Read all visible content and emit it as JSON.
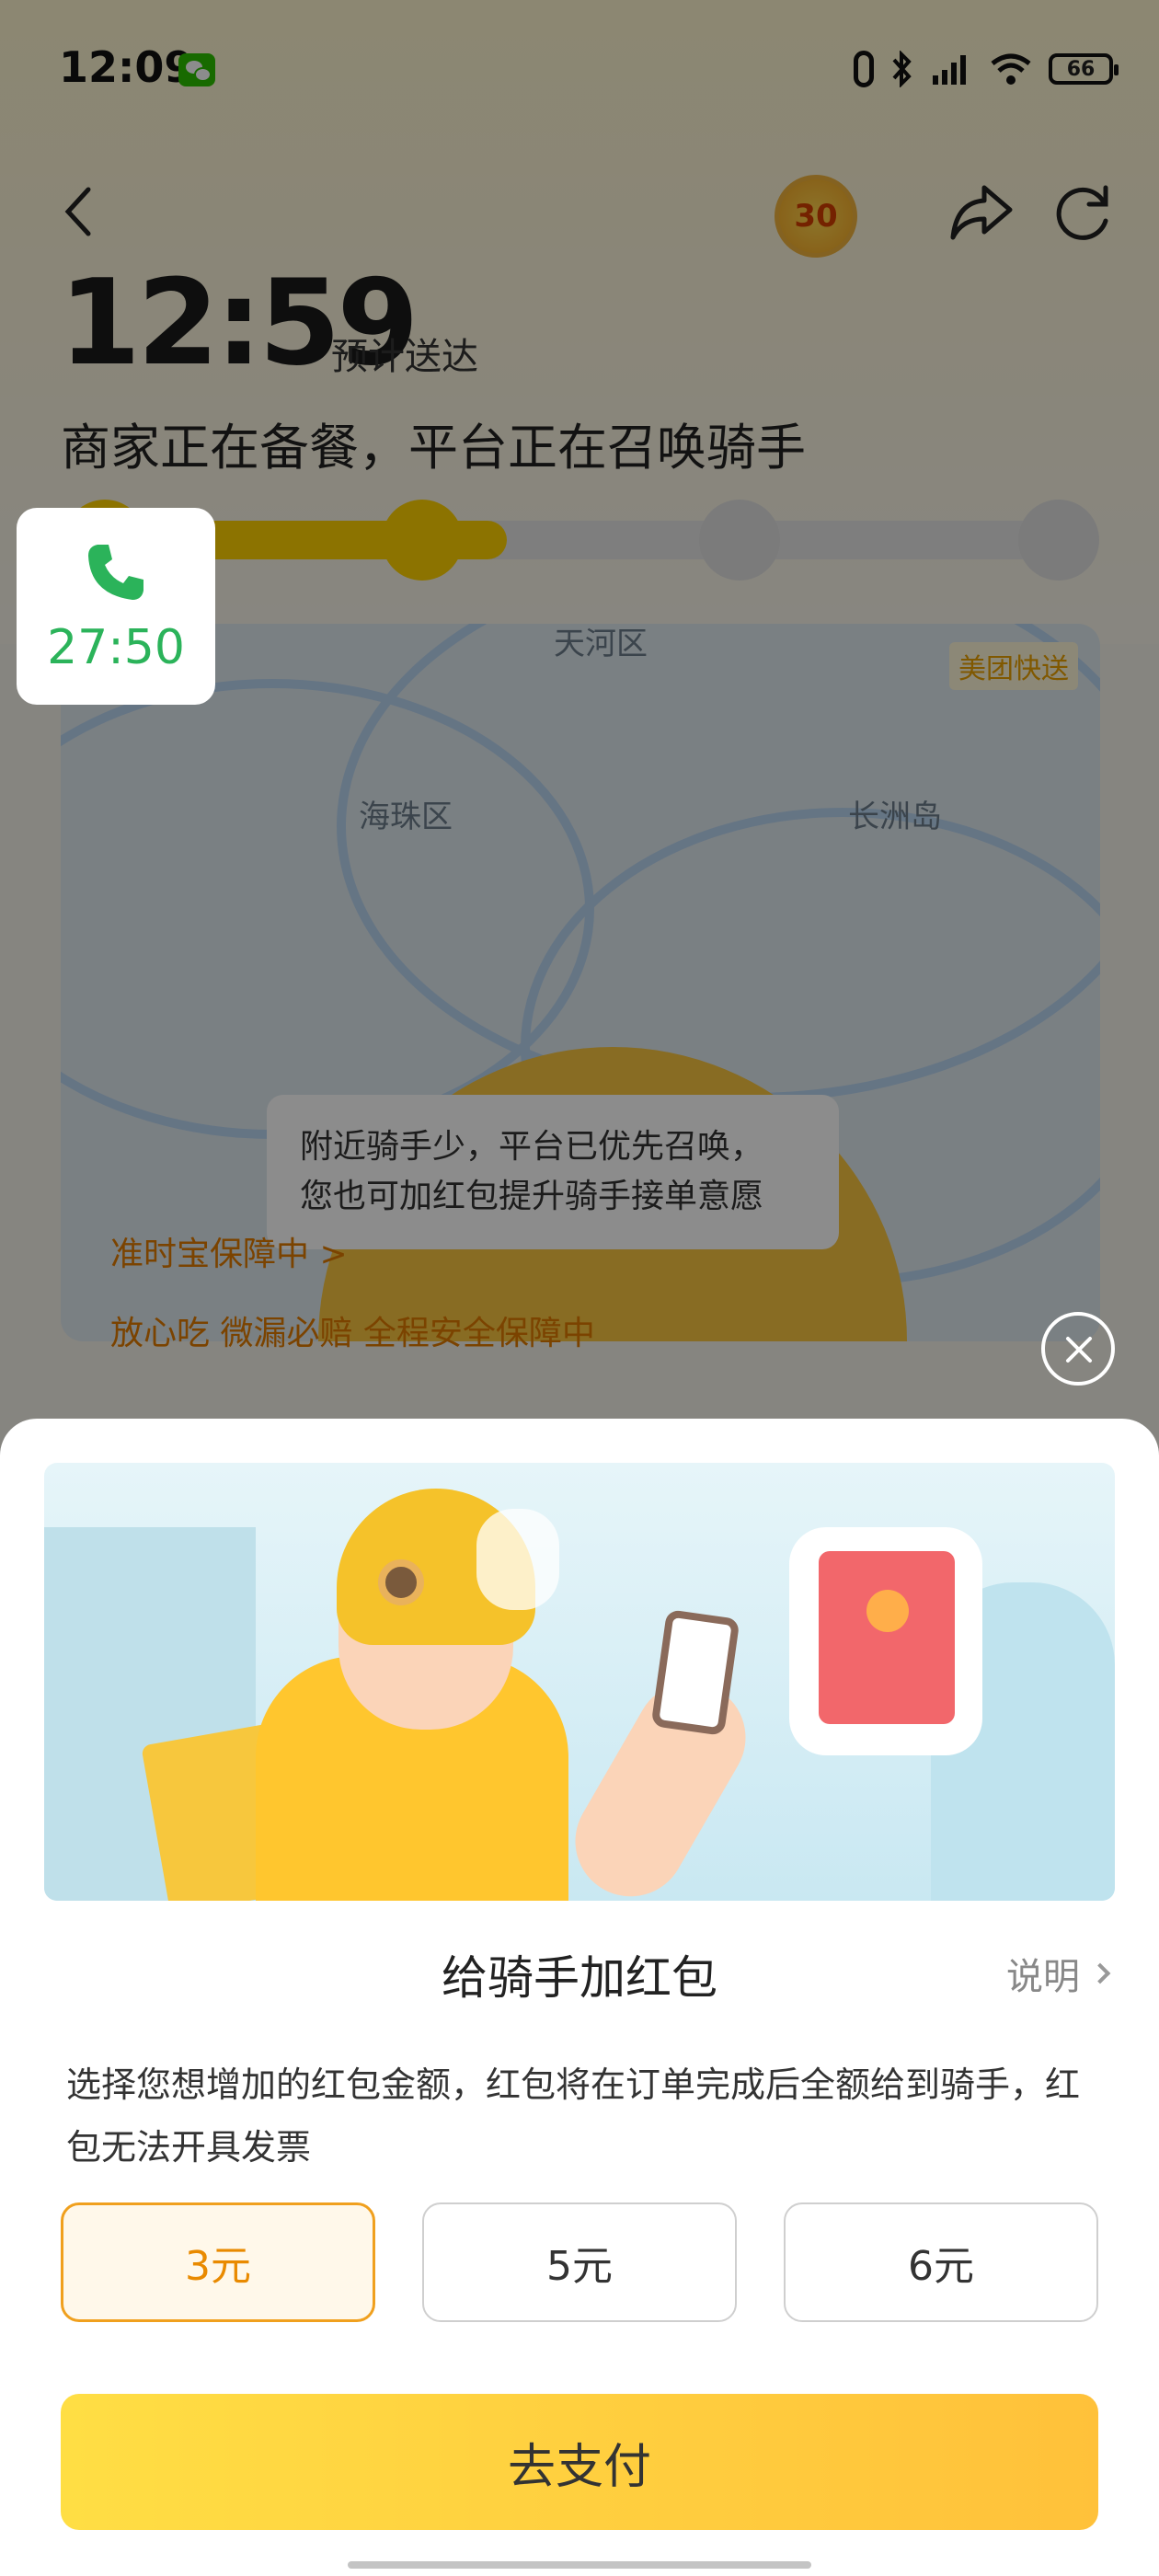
{
  "status_bar": {
    "time": "12:09",
    "battery": "66"
  },
  "header": {
    "coin_badge": "30",
    "eta_time": "12:59",
    "eta_label": "预计送达",
    "order_status": "商家正在备餐，平台正在召唤骑手"
  },
  "progress": {
    "fraction": 0.26
  },
  "map": {
    "labels": [
      "天河区",
      "海珠区",
      "长洲岛"
    ],
    "brand": "美团快送",
    "tip_line1": "附近骑手少，平台已优先召唤，",
    "tip_line2": "您也可加红包提升骑手接单意愿",
    "guarantee": "准时宝保障中 >",
    "guarantee2": "放心吃 微漏必赔 全程安全保障中"
  },
  "call_card": {
    "time": "27:50",
    "accent": "#2bb35a"
  },
  "sheet": {
    "title": "给骑手加红包",
    "help_link": "说明",
    "description": "选择您想增加的红包金额，红包将在订单完成后全额给到骑手，红包无法开具发票",
    "amounts": [
      "3元",
      "5元",
      "6元"
    ],
    "selected_amount": "3元",
    "pay_button": "去支付",
    "accent": "#f0a01e"
  }
}
